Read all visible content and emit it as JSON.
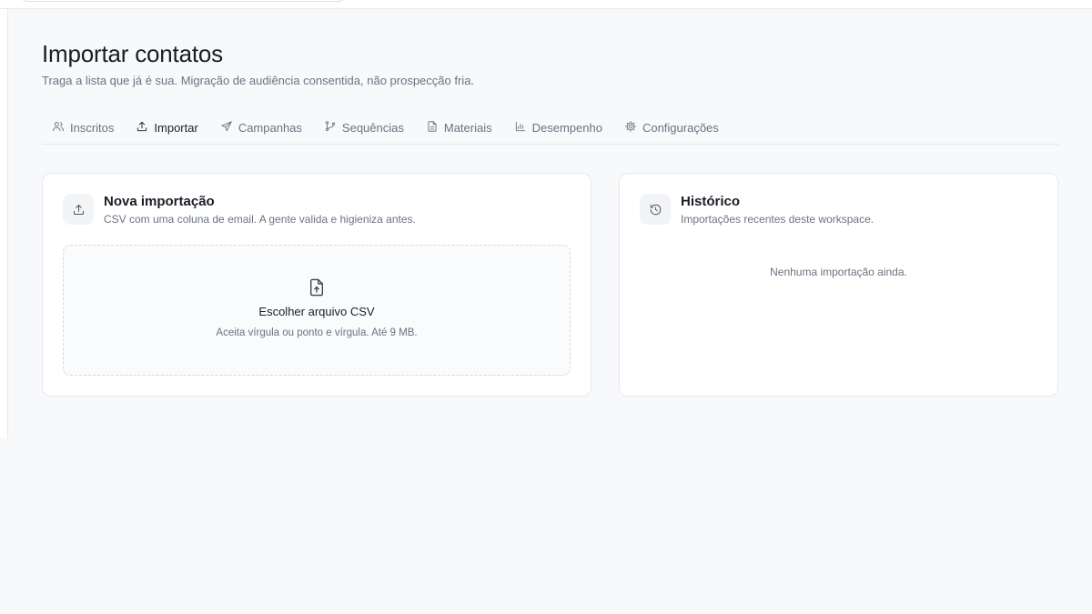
{
  "page": {
    "title": "Importar contatos",
    "subtitle": "Traga a lista que já é sua. Migração de audiência consentida, não prospecção fria."
  },
  "tabs": [
    {
      "label": "Inscritos",
      "icon": "users-icon",
      "active": false
    },
    {
      "label": "Importar",
      "icon": "upload-icon",
      "active": true
    },
    {
      "label": "Campanhas",
      "icon": "send-icon",
      "active": false
    },
    {
      "label": "Sequências",
      "icon": "git-branch-icon",
      "active": false
    },
    {
      "label": "Materiais",
      "icon": "file-text-icon",
      "active": false
    },
    {
      "label": "Desempenho",
      "icon": "bar-chart-icon",
      "active": false
    },
    {
      "label": "Configurações",
      "icon": "gear-icon",
      "active": false
    }
  ],
  "new_import": {
    "title": "Nova importação",
    "description": "CSV com uma coluna de email. A gente valida e higieniza antes.",
    "dropzone_title": "Escolher arquivo CSV",
    "dropzone_hint": "Aceita vírgula ou ponto e vírgula. Até 9 MB."
  },
  "history": {
    "title": "Histórico",
    "description": "Importações recentes deste workspace.",
    "empty_text": "Nenhuma importação ainda."
  },
  "colors": {
    "background": "#f8f9fb",
    "card": "#ffffff",
    "border": "#e7e9ed",
    "text_primary": "#1a1d24",
    "text_muted": "#6b7280"
  }
}
